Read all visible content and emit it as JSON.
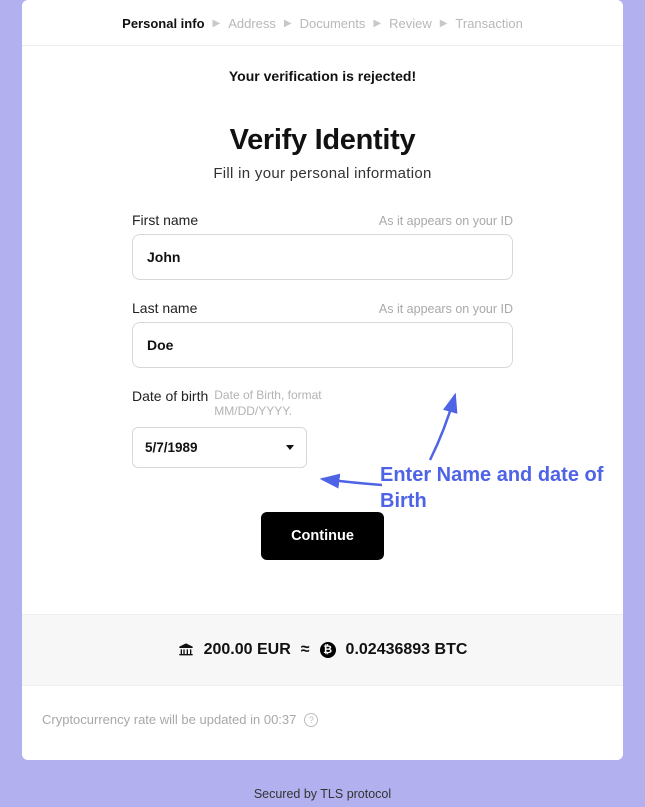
{
  "breadcrumb": {
    "items": [
      {
        "label": "Personal info",
        "active": true
      },
      {
        "label": "Address",
        "active": false
      },
      {
        "label": "Documents",
        "active": false
      },
      {
        "label": "Review",
        "active": false
      },
      {
        "label": "Transaction",
        "active": false
      }
    ]
  },
  "banner": {
    "text": "Your verification is rejected!"
  },
  "heading": {
    "title": "Verify Identity",
    "subtitle": "Fill in your personal information"
  },
  "form": {
    "first_name": {
      "label": "First name",
      "hint": "As it appears on your ID",
      "value": "John"
    },
    "last_name": {
      "label": "Last name",
      "hint": "As it appears on your ID",
      "value": "Doe"
    },
    "dob": {
      "label": "Date of birth",
      "hint": "Date of Birth, format MM/DD/YYYY.",
      "value": "5/7/1989"
    }
  },
  "buttons": {
    "continue": "Continue"
  },
  "summary": {
    "fiat_amount": "200.00 EUR",
    "approx": "≈",
    "crypto_amount": "0.02436893 BTC"
  },
  "rate": {
    "prefix": "Cryptocurrency rate will be updated in ",
    "time": "00:37"
  },
  "footer": {
    "text": "Secured by TLS protocol"
  },
  "annotation": {
    "text": "Enter Name and date of Birth"
  },
  "colors": {
    "accent": "#4f63e6",
    "bg": "#b2b0ee"
  }
}
